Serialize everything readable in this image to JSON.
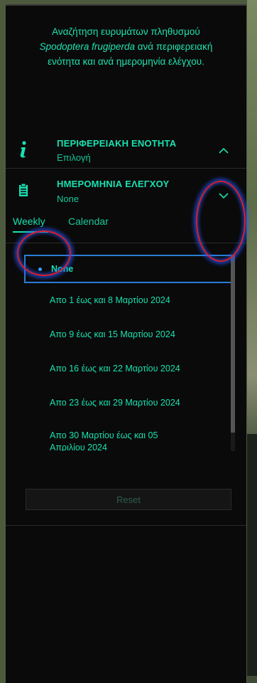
{
  "header": {
    "line1": "Αναζήτηση ευρυμάτων πληθυσμού",
    "species": "Spodoptera frugiperda",
    "line2_rest": " ανά περιφερειακή",
    "line3": "ενότητα και ανά ημερομηνία ελέγχου."
  },
  "region_section": {
    "title": "ΠΕΡΙΦΕΡΕΙΑΚΗ ΕΝΟΤΗΤΑ",
    "value": "Επιλογή",
    "icon": "info-icon"
  },
  "date_section": {
    "title": "ΗΜΕΡΟΜΗΝΙΑ ΕΛΕΓΧΟΥ",
    "value": "None",
    "icon": "clipboard-icon"
  },
  "tabs": [
    {
      "label": "Weekly",
      "active": true
    },
    {
      "label": "Calendar",
      "active": false
    }
  ],
  "options": [
    {
      "label": "None",
      "selected": true
    },
    {
      "label": "Απο 1 έως και 8 Μαρτίου 2024",
      "selected": false
    },
    {
      "label": "Απο 9 έως και 15 Μαρτίου 2024",
      "selected": false
    },
    {
      "label": "Απο 16 έως και 22 Μαρτίου 2024",
      "selected": false
    },
    {
      "label": "Απο 23 έως και 29 Μαρτίου 2024",
      "selected": false
    },
    {
      "label": "Απο 30 Μαρτίου έως και 05 Απριλίου 2024",
      "selected": false
    }
  ],
  "reset_label": "Reset",
  "colors": {
    "accent": "#19e1b0",
    "selection_border": "#2a7dd6",
    "annotation": "#d81f2a"
  }
}
